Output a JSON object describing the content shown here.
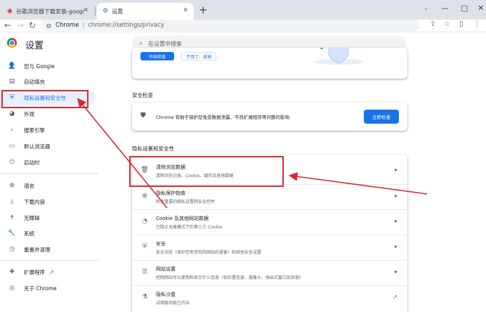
{
  "browser": {
    "tabs": [
      {
        "title": "谷歌浏览器下载安装-google ch",
        "active": false
      },
      {
        "title": "设置",
        "active": true
      }
    ],
    "new_tab": "+",
    "tab_close": "✕",
    "address": {
      "host": "Chrome",
      "separator": "|",
      "path": "chrome://settings/privacy"
    }
  },
  "header": {
    "title": "设置",
    "search_placeholder": "在设置中搜索"
  },
  "sidebar": {
    "items": [
      {
        "label": "您与 Google",
        "icon": "person-icon"
      },
      {
        "label": "自动填充",
        "icon": "clipboard-icon"
      },
      {
        "label": "隐私设置和安全性",
        "icon": "shield-icon",
        "active": true
      },
      {
        "label": "外观",
        "icon": "palette-icon"
      },
      {
        "label": "搜索引擎",
        "icon": "search-icon"
      },
      {
        "label": "默认浏览器",
        "icon": "browser-icon"
      },
      {
        "label": "启动时",
        "icon": "power-icon"
      },
      {
        "label": "语言",
        "icon": "globe-icon"
      },
      {
        "label": "下载内容",
        "icon": "download-icon"
      },
      {
        "label": "无障碍",
        "icon": "accessibility-icon"
      },
      {
        "label": "系统",
        "icon": "wrench-icon"
      },
      {
        "label": "重置并清理",
        "icon": "reset-icon"
      },
      {
        "label": "扩展程序",
        "icon": "puzzle-icon"
      },
      {
        "label": "关于 Chrome",
        "icon": "chrome-icon"
      }
    ]
  },
  "main": {
    "top_card": {
      "primary_button": "开始检查",
      "secondary_button": "不用了，谢谢"
    },
    "safety_check": {
      "section_title": "安全检查",
      "text": "Chrome 有助于保护您免受数据泄露、不良扩展程序等问题的影响",
      "button": "立即检查"
    },
    "privacy": {
      "section_title": "隐私设置和安全性",
      "rows": [
        {
          "title": "清除浏览数据",
          "subtitle": "清除浏览记录、Cookie、缓存及其他数据",
          "icon": "trash-icon",
          "action": "arrow"
        },
        {
          "title": "隐私保护指南",
          "subtitle": "检查重要的隐私设置和安全控件",
          "icon": "compass-icon",
          "action": "arrow"
        },
        {
          "title": "Cookie 及其他网站数据",
          "subtitle": "已阻止无痕模式下的第三方 Cookie",
          "icon": "cookie-icon",
          "action": "arrow"
        },
        {
          "title": "安全",
          "subtitle": "安全浏览（保护您免受危险网站的侵害）和其他安全设置",
          "icon": "shield-icon",
          "action": "arrow"
        },
        {
          "title": "网站设置",
          "subtitle": "控制网站可以使用和显示什么信息（如位置信息、摄像头、弹出式窗口及其他）",
          "icon": "sliders-icon",
          "action": "arrow"
        },
        {
          "title": "隐私沙盒",
          "subtitle": "试用版功能已开启",
          "icon": "flask-icon",
          "action": "external"
        }
      ]
    }
  },
  "colors": {
    "accent": "#1a73e8",
    "annotation": "#d9282f",
    "active_bg": "#e8f0fe"
  }
}
